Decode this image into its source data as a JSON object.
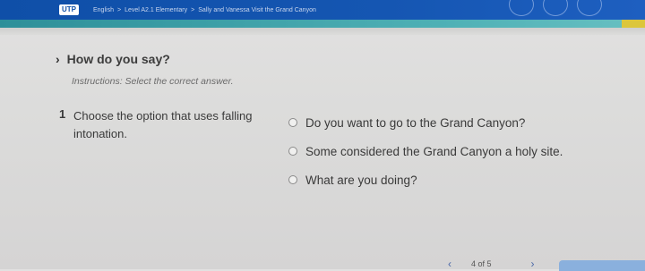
{
  "header": {
    "logo": "UTP",
    "breadcrumbs": [
      "English",
      "Level A2.1 Elementary",
      "Sally and Vanessa Visit the Grand Canyon"
    ],
    "separator": ">"
  },
  "section": {
    "chevron": "›",
    "title": "How do you say?",
    "instructions": "Instructions: Select the correct answer."
  },
  "question": {
    "number": "1",
    "text": "Choose the option that uses falling intonation.",
    "options": [
      "Do you want to go to the Grand Canyon?",
      "Some considered the Grand Canyon a holy site.",
      "What are you doing?"
    ]
  },
  "pager": {
    "prev": "‹",
    "label": "4 of 5",
    "next": "›"
  },
  "colors": {
    "topbar": "#0f4fa8",
    "strip": "#4fb1b6",
    "accent": "#dcc63b",
    "next_button": "#8ab0dd"
  }
}
